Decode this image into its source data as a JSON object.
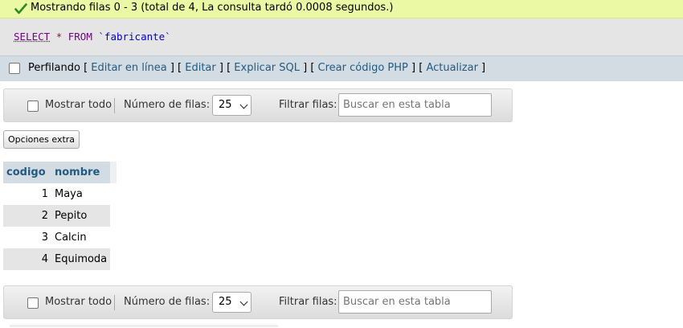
{
  "result_message": "Mostrando filas 0 - 3 (total de 4, La consulta tardó 0.0008 segundos.)",
  "sql": {
    "select": "SELECT",
    "star": "*",
    "from": "FROM",
    "table": "`fabricante`"
  },
  "profiling": {
    "label": "Perfilando",
    "links": [
      "Editar en línea",
      "Editar",
      "Explicar SQL",
      "Crear código PHP",
      "Actualizar"
    ]
  },
  "navigation": {
    "show_all_label": "Mostrar todo",
    "rows_label": "Número de filas:",
    "rows_value": "25",
    "filter_label": "Filtrar filas:",
    "search_placeholder": "Buscar en esta tabla"
  },
  "extra_options_label": "Opciones extra",
  "table": {
    "columns": [
      "codigo",
      "nombre"
    ],
    "rows": [
      [
        "1",
        "Maya"
      ],
      [
        "2",
        "Pepito"
      ],
      [
        "3",
        "Calcin"
      ],
      [
        "4",
        "Equimoda"
      ]
    ]
  },
  "colors": {
    "success_bg": "#ebf8a4",
    "header_bg": "#d3dce3",
    "link": "#235a81"
  }
}
